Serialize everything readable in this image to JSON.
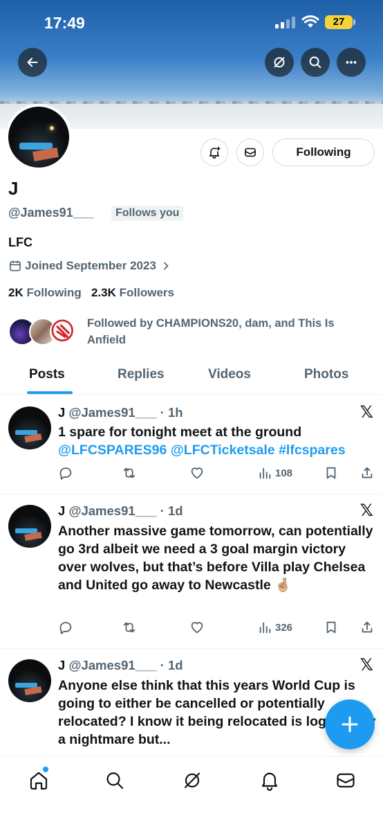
{
  "status_bar": {
    "time": "17:49",
    "battery": "27"
  },
  "profile": {
    "name": "J",
    "handle": "@James91___",
    "follows_you": "Follows you",
    "bio": "LFC",
    "joined": "Joined September 2023",
    "following_count": "2K",
    "following_label": "Following",
    "followers_count": "2.3K",
    "followers_label": "Followers",
    "followed_by": "Followed by CHAMPIONS20, dam, and This Is Anfield",
    "following_button": "Following"
  },
  "tabs": [
    {
      "label": "Posts"
    },
    {
      "label": "Replies"
    },
    {
      "label": "Videos"
    },
    {
      "label": "Photos"
    }
  ],
  "posts": [
    {
      "name": "J",
      "handle": "@James91___",
      "time": "· 1h",
      "text": "1 spare for tonight meet at the ground",
      "links": "@LFCSPARES96 @LFCTicketsale #lfcspares",
      "views": "108"
    },
    {
      "name": "J",
      "handle": "@James91___",
      "time": "· 1d",
      "text": "Another massive game tomorrow, can potentially go 3rd albeit we need a 3 goal margin victory over wolves, but that’s before Villa play Chelsea and United go away to Newcastle 🤞🏼",
      "views": "326"
    },
    {
      "name": "J",
      "handle": "@James91___",
      "time": "· 1d",
      "text": "Anyone else think that this years World Cup is going to either be cancelled or potentially relocated? I know it being relocated is logistically a nightmare but..."
    }
  ],
  "icons": {
    "back": "arrow-left-icon",
    "grok": "grok-icon",
    "search": "search-icon",
    "more": "more-icon",
    "notify": "bell-plus-icon",
    "message": "envelope-icon",
    "calendar": "calendar-icon",
    "x": "x-logo-icon",
    "compose": "plus-icon"
  },
  "colors": {
    "accent": "#1d9bf0",
    "text": "#0f1419",
    "muted": "#536471"
  }
}
